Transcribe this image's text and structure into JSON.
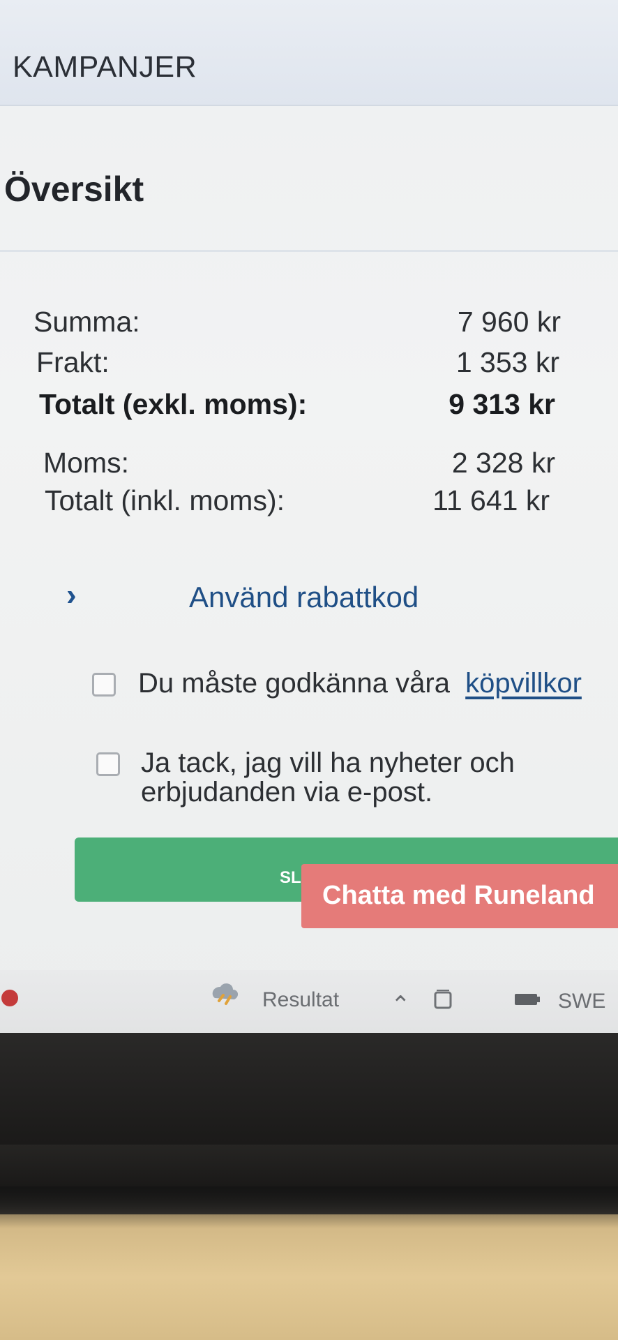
{
  "header": {
    "label": "KAMPANJER"
  },
  "summary": {
    "title": "Översikt",
    "rows": [
      {
        "label": "Summa:",
        "value": "7 960 kr"
      },
      {
        "label": "Frakt:",
        "value": "1 353 kr"
      },
      {
        "label": "Totalt (exkl. moms):",
        "value": "9 313 kr"
      },
      {
        "label": "Moms:",
        "value": "2 328 kr"
      },
      {
        "label": "Totalt (inkl. moms):",
        "value": "11 641 kr"
      }
    ]
  },
  "discount": {
    "chevron": "›",
    "label": "Använd rabattkod"
  },
  "terms": {
    "text": "Du måste godkänna våra",
    "link": "köpvillkor",
    "checked": false
  },
  "newsletter": {
    "line1": "Ja tack, jag vill ha nyheter och",
    "line2": "erbjudanden via e-post.",
    "checked": false
  },
  "checkout_button": {
    "label": "SL",
    "color": "#4caf78"
  },
  "chat": {
    "label": "Chatta med Runeland",
    "color": "#e57b79"
  },
  "taskbar": {
    "weather": "Resultat",
    "caret": "⌃",
    "language": "SWE"
  }
}
